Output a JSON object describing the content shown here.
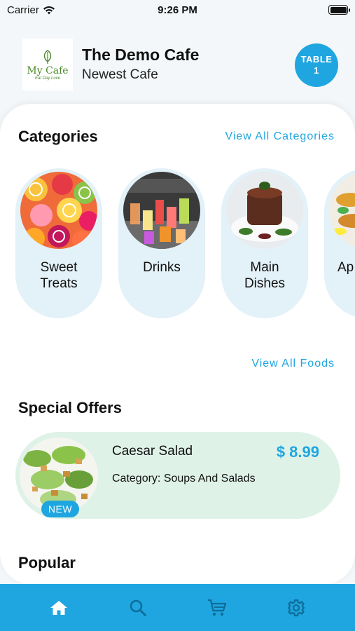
{
  "status": {
    "carrier": "Carrier",
    "time": "9:26 PM"
  },
  "header": {
    "logo_name": "My Cafe",
    "logo_tagline": "Eat Day Love",
    "cafe_name": "The Demo Cafe",
    "cafe_subtitle": "Newest Cafe",
    "table_label": "TABLE",
    "table_number": "1"
  },
  "categories": {
    "title": "Categories",
    "view_all": "View All Categories",
    "items": [
      {
        "line1": "Sweet",
        "line2": "Treats",
        "image": "candy-image"
      },
      {
        "line1": "Drinks",
        "line2": "",
        "image": "drinks-image"
      },
      {
        "line1": "Main",
        "line2": "Dishes",
        "image": "steak-image"
      },
      {
        "line1": "Ap",
        "line2": "",
        "image": "appetizer-image"
      }
    ]
  },
  "foods": {
    "view_all": "View All Foods"
  },
  "special_offers": {
    "title": "Special Offers",
    "item": {
      "name": "Caesar Salad",
      "price": "$ 8.99",
      "category": "Category: Soups And Salads",
      "badge": "NEW"
    }
  },
  "popular": {
    "title": "Popular"
  },
  "tabbar": {
    "items": [
      "home-icon",
      "search-icon",
      "cart-icon",
      "settings-icon"
    ],
    "accent": "#1fa6e0"
  },
  "colors": {
    "accent": "#1fa6e0",
    "category_bg": "#e3f1f8",
    "offer_bg": "#dff2e8"
  }
}
